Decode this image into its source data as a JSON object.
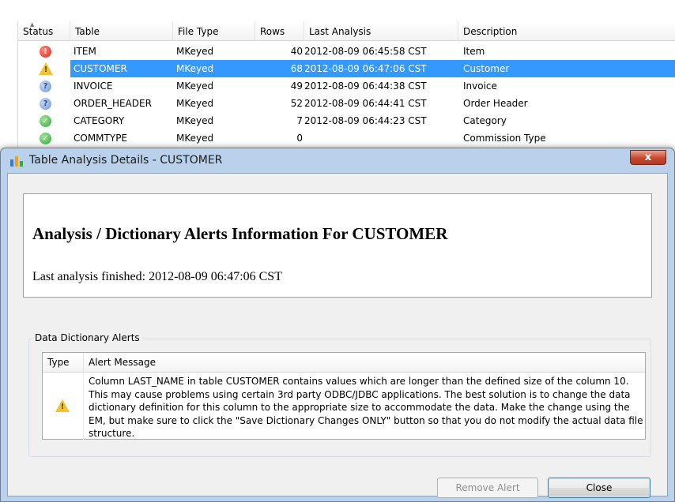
{
  "table": {
    "columns": [
      "Status",
      "Table",
      "File Type",
      "Rows",
      "Last Analysis",
      "Description"
    ],
    "rows": [
      {
        "status": "error",
        "table": "ITEM",
        "file_type": "MKeyed",
        "rows": "40",
        "last_analysis": "2012-08-09 06:45:58 CST",
        "description": "Item"
      },
      {
        "status": "warning",
        "table": "CUSTOMER",
        "file_type": "MKeyed",
        "rows": "68",
        "last_analysis": "2012-08-09 06:47:06 CST",
        "description": "Customer",
        "selected": true
      },
      {
        "status": "info",
        "table": "INVOICE",
        "file_type": "MKeyed",
        "rows": "49",
        "last_analysis": "2012-08-09 06:44:38 CST",
        "description": "Invoice"
      },
      {
        "status": "info",
        "table": "ORDER_HEADER",
        "file_type": "MKeyed",
        "rows": "52",
        "last_analysis": "2012-08-09 06:44:41 CST",
        "description": "Order Header"
      },
      {
        "status": "ok",
        "table": "CATEGORY",
        "file_type": "MKeyed",
        "rows": "7",
        "last_analysis": "2012-08-09 06:44:23 CST",
        "description": "Category"
      },
      {
        "status": "ok",
        "table": "COMMTYPE",
        "file_type": "MKeyed",
        "rows": "0",
        "last_analysis": "",
        "description": "Commission Type"
      }
    ]
  },
  "dialog": {
    "title": "Table Analysis Details - CUSTOMER",
    "close_glyph": "x",
    "heading": "Analysis / Dictionary Alerts Information For CUSTOMER",
    "last_analysis": "Last analysis finished: 2012-08-09 06:47:06 CST",
    "group_label": "Data Dictionary Alerts",
    "alert_columns": [
      "Type",
      "Alert Message"
    ],
    "alerts": [
      {
        "type": "warning",
        "message": "Column LAST_NAME in table CUSTOMER contains values which are longer than the defined size of the column 10. This may cause problems using certain 3rd party ODBC/JDBC applications. The best solution is to change the data dictionary definition for this column to the appropriate size to accommodate the data. Make the change using the EM, but make sure to click the \"Save Dictionary Changes ONLY\" button so that you do not modify the actual data file structure."
      }
    ],
    "remove_alert_label": "Remove Alert",
    "close_label": "Close"
  },
  "icons": {
    "error": "error-circle-icon",
    "warning": "warning-triangle-icon",
    "info": "info-circle-icon",
    "ok": "check-circle-icon",
    "window": "table-analysis-app-icon"
  },
  "colors": {
    "selection": "#3399ff",
    "window_frame": "#b9d1ea",
    "close_button": "#c7462d"
  }
}
